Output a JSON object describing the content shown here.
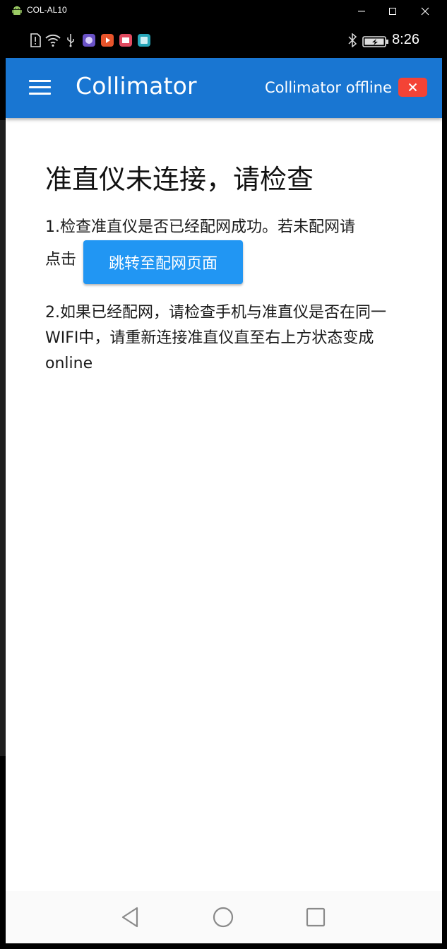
{
  "host_window": {
    "title": "COL-AL10",
    "controls": [
      "minimize-icon",
      "maximize-icon",
      "close-icon"
    ]
  },
  "status_bar": {
    "time": "8:26",
    "icons": [
      "sim-alert-icon",
      "wifi-icon",
      "usb-icon",
      "app-icon-purple",
      "app-icon-orange",
      "app-icon-red",
      "app-icon-teal",
      "bluetooth-icon",
      "battery-charging-icon"
    ]
  },
  "app_bar": {
    "title": "Collimator",
    "status_text": "Collimator offline",
    "menu_icon": "hamburger-menu-icon",
    "status_icon": "close-icon",
    "colors": {
      "bar": "#1976d2",
      "badge": "#f44336"
    }
  },
  "main": {
    "heading": "准直仪未连接，请检查",
    "step1_line1": "1.检查准直仪是否已经配网成功。若未配网请",
    "step1_line2_prefix": "点击",
    "goto_button_label": "跳转至配网页面",
    "step2": "2.如果已经配网，请检查手机与准直仪是否在同一WIFI中，请重新连接准直仪直至右上方状态变成online",
    "colors": {
      "button": "#2196f3"
    }
  },
  "nav_bar": {
    "buttons": [
      "back-triangle-icon",
      "home-circle-icon",
      "recents-square-icon"
    ]
  }
}
